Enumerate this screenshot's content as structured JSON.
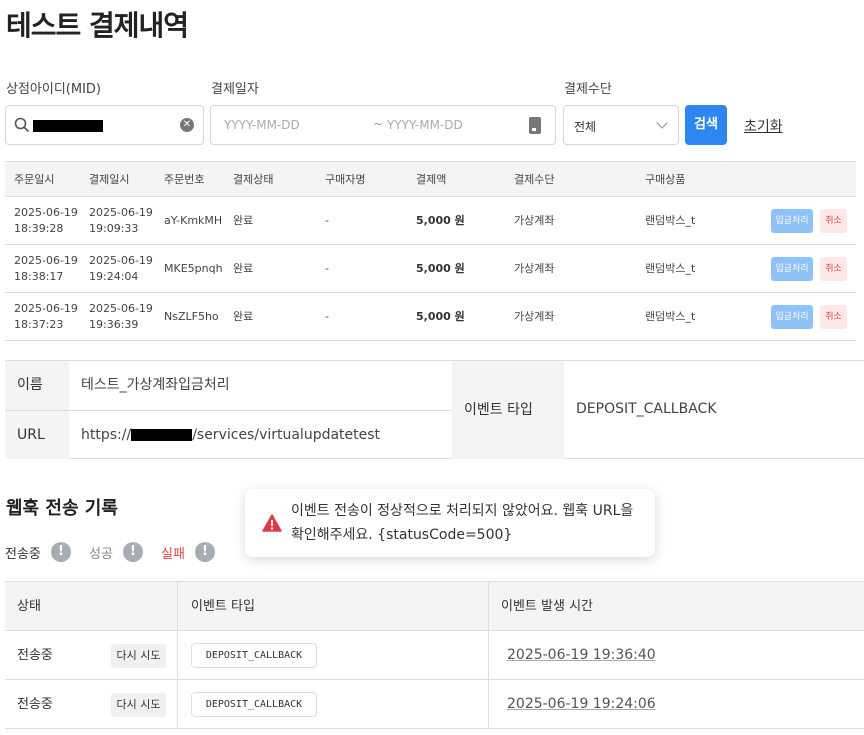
{
  "page": {
    "title": "테스트 결제내역"
  },
  "filters": {
    "mid_label": "상점아이디(MID)",
    "date_label": "결제일자",
    "date_from_placeholder": "YYYY-MM-DD",
    "date_sep": "~",
    "date_to_placeholder": "YYYY-MM-DD",
    "method_label": "결제수단",
    "method_value": "전체",
    "search_button": "검색",
    "reset_button": "초기화"
  },
  "payments": {
    "headers": [
      "주문일시",
      "결제일시",
      "주문번호",
      "결제상태",
      "구매자명",
      "결제액",
      "결제수단",
      "구매상품"
    ],
    "rows": [
      {
        "order_date": "2025-06-19",
        "order_time": "18:39:28",
        "paid_date": "2025-06-19",
        "paid_time": "19:09:33",
        "order_no": "aY-KmkMH",
        "status": "완료",
        "buyer": "-",
        "amount": "5,000 원",
        "method": "가상계좌",
        "product": "랜덤박스_t",
        "deposit_btn": "입금처리",
        "cancel_btn": "취소"
      },
      {
        "order_date": "2025-06-19",
        "order_time": "18:38:17",
        "paid_date": "2025-06-19",
        "paid_time": "19:24:04",
        "order_no": "MKE5pnqh",
        "status": "완료",
        "buyer": "-",
        "amount": "5,000 원",
        "method": "가상계좌",
        "product": "랜덤박스_t",
        "deposit_btn": "입금처리",
        "cancel_btn": "취소"
      },
      {
        "order_date": "2025-06-19",
        "order_time": "18:37:23",
        "paid_date": "2025-06-19",
        "paid_time": "19:36:39",
        "order_no": "NsZLF5ho",
        "status": "완료",
        "buyer": "-",
        "amount": "5,000 원",
        "method": "가상계좌",
        "product": "랜덤박스_t",
        "deposit_btn": "입금처리",
        "cancel_btn": "취소"
      }
    ]
  },
  "webhook_info": {
    "name_label": "이름",
    "name_value": "테스트_가상계좌입금처리",
    "url_label": "URL",
    "url_prefix": "https://",
    "url_suffix": "/services/virtualupdatetest",
    "event_type_label": "이벤트 타입",
    "event_type_value": "DEPOSIT_CALLBACK"
  },
  "history": {
    "title": "웹훅 전송 기록",
    "statuses": [
      {
        "label": "전송중",
        "color": "#333333"
      },
      {
        "label": "성공",
        "color": "#888888"
      },
      {
        "label": "실패",
        "color": "#e04a4a"
      }
    ],
    "headers": [
      "상태",
      "이벤트 타입",
      "이벤트 발생 시간"
    ],
    "rows": [
      {
        "status": "전송중",
        "retry": "다시 시도",
        "event_type": "DEPOSIT_CALLBACK",
        "time": "2025-06-19 19:36:40"
      },
      {
        "status": "전송중",
        "retry": "다시 시도",
        "event_type": "DEPOSIT_CALLBACK",
        "time": "2025-06-19 19:24:06"
      }
    ]
  },
  "toast": {
    "message": "이벤트 전송이 정상적으로 처리되지 않았어요. 웹훅 URL을 확인해주세요. {statusCode=500}",
    "icon": "warning-icon",
    "color": "#e03a4a"
  }
}
